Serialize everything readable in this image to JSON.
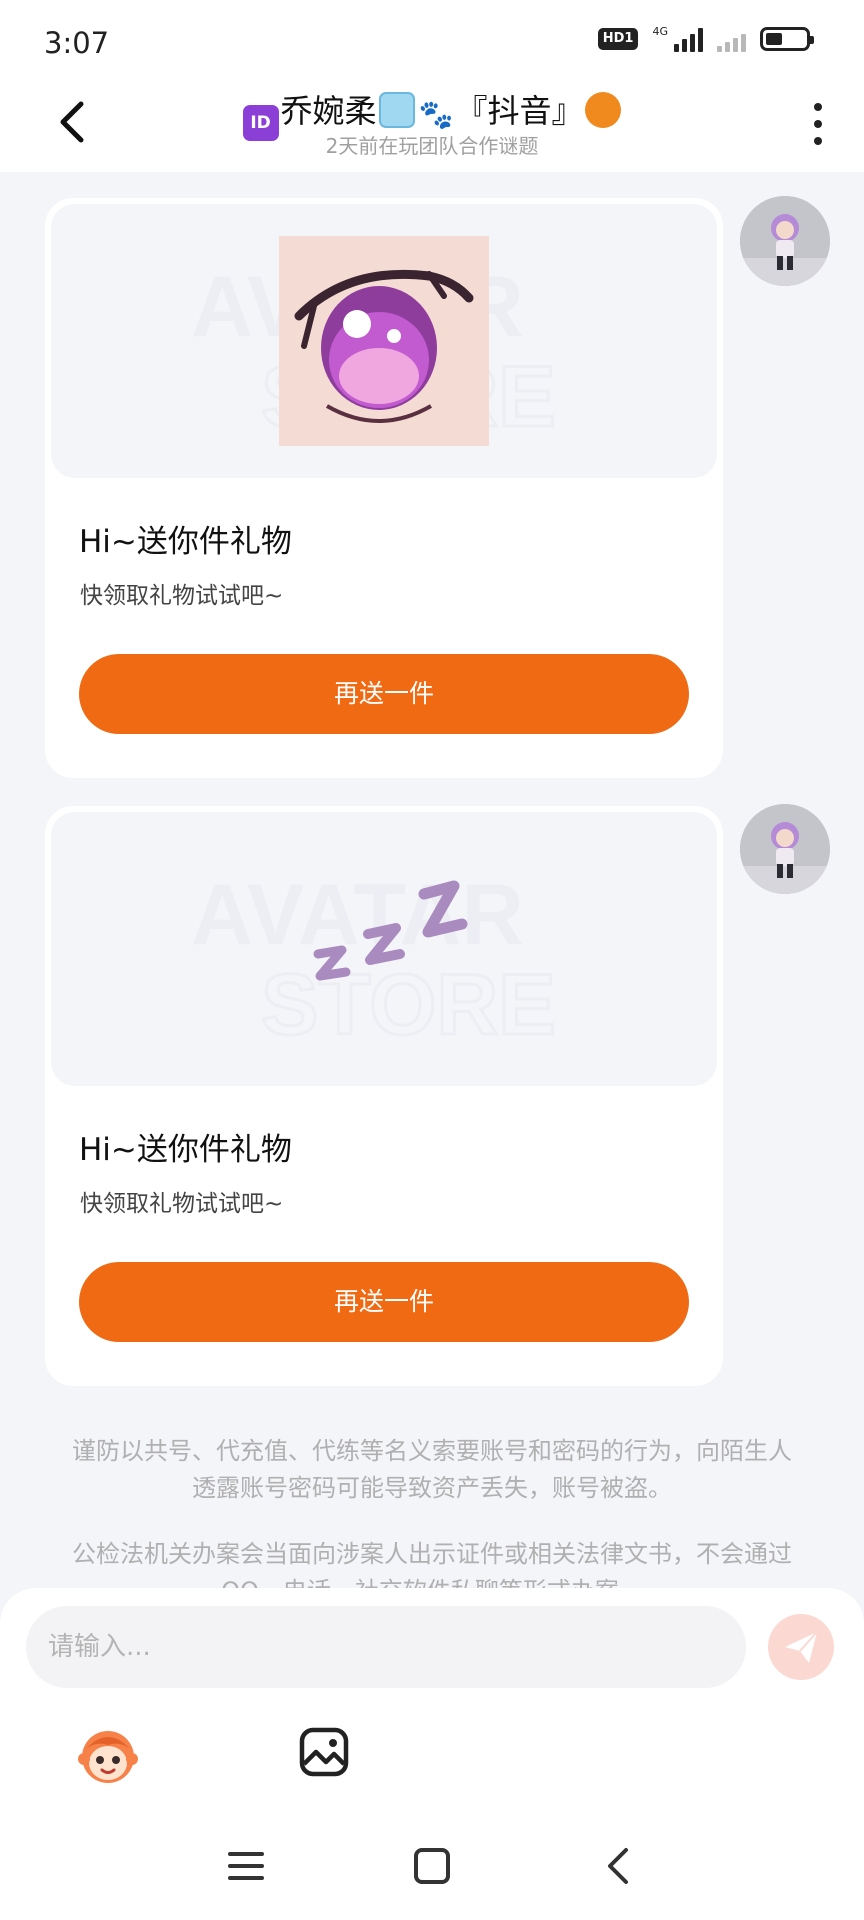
{
  "status_bar": {
    "time": "3:07",
    "hd_badge": "HD1",
    "network_label": "4G"
  },
  "header": {
    "title_name": "乔婉柔",
    "title_suffix": "『抖音』",
    "subtitle": "2天前在玩团队合作谜题",
    "back_icon": "chevron-left-icon",
    "more_icon": "more-vertical-icon"
  },
  "messages": [
    {
      "preview": "pink-anime-eye-sticker",
      "title": "Hi~送你件礼物",
      "description": "快领取礼物试试吧~",
      "button_label": "再送一件"
    },
    {
      "preview": "zzz-sleep-sticker",
      "title": "Hi~送你件礼物",
      "description": "快领取礼物试试吧~",
      "button_label": "再送一件"
    }
  ],
  "notices": [
    "谨防以共号、代充值、代练等名义索要账号和密码的行为，向陌生人透露账号密码可能导致资产丢失，账号被盗。",
    "公检法机关办案会当面向涉案人出示证件或相关法律文书，不会通过QQ、电话、社交软件私聊等形式办案。"
  ],
  "input": {
    "placeholder": "请输入..."
  },
  "colors": {
    "accent": "#f06a14",
    "background": "#f4f5f9",
    "send_button": "#fbd9d2"
  }
}
